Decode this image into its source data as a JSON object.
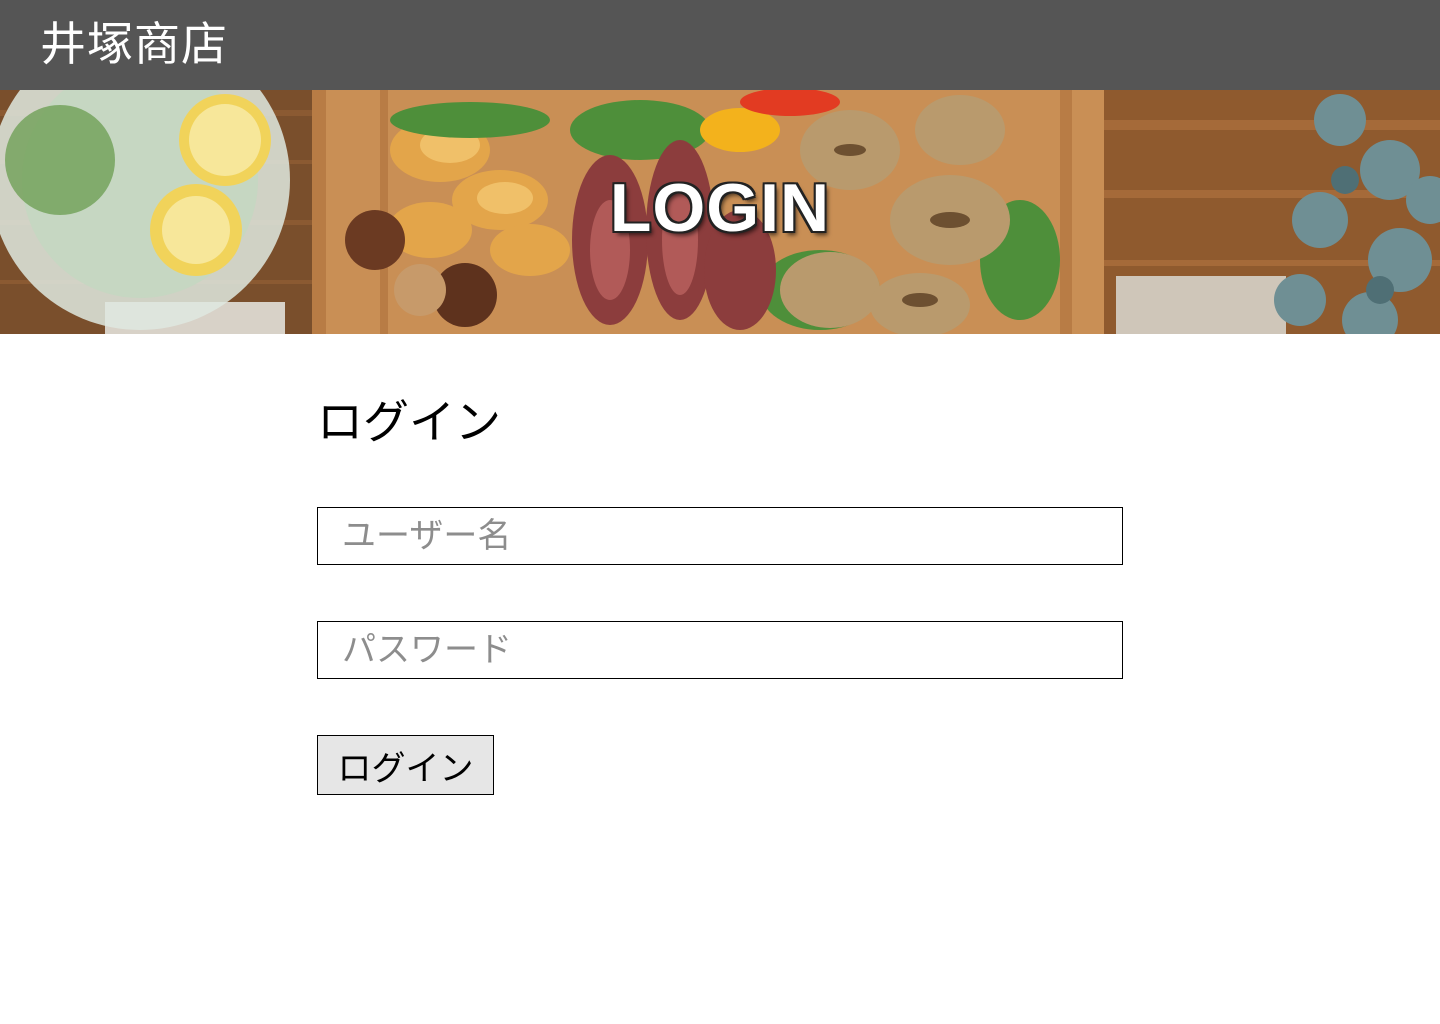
{
  "header": {
    "site_title": "井塚商店",
    "background_color": "#555555"
  },
  "hero": {
    "title": "LOGIN",
    "image": "food-platter-banner"
  },
  "login": {
    "heading": "ログイン",
    "username_placeholder": "ユーザー名",
    "username_value": "",
    "password_placeholder": "パスワード",
    "password_value": "",
    "submit_label": "ログイン"
  }
}
